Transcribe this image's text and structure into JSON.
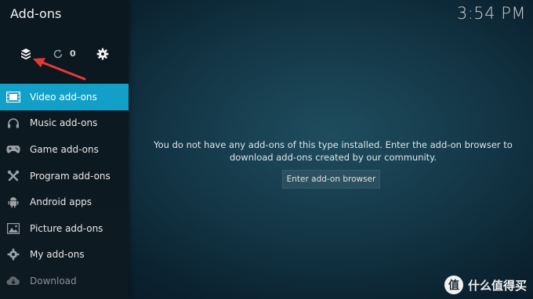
{
  "window": {
    "title": "Add-ons",
    "clock": "3:54 PM"
  },
  "toolbar": {
    "addon_browser_icon": "open-box-icon",
    "update_icon": "refresh-icon",
    "update_count": "0",
    "settings_icon": "gear-icon"
  },
  "sidebar": {
    "items": [
      {
        "label": "Video add-ons",
        "icon": "film-icon",
        "active": true
      },
      {
        "label": "Music add-ons",
        "icon": "headphones-icon"
      },
      {
        "label": "Game add-ons",
        "icon": "gamepad-icon"
      },
      {
        "label": "Program add-ons",
        "icon": "tools-icon"
      },
      {
        "label": "Android apps",
        "icon": "android-icon"
      },
      {
        "label": "Picture add-ons",
        "icon": "picture-icon"
      },
      {
        "label": "My add-ons",
        "icon": "gear-icon"
      },
      {
        "label": "Download",
        "icon": "cloud-download-icon",
        "disabled": true
      }
    ]
  },
  "main": {
    "message": "You do not have any add-ons of this type installed. Enter the add-on browser to download add-ons created by our community.",
    "browse_button": "Enter add-on browser"
  },
  "watermark": {
    "badge": "值",
    "text": "什么值得买"
  },
  "colors": {
    "accent": "#12a0c8",
    "annotation_arrow": "#e53935"
  }
}
